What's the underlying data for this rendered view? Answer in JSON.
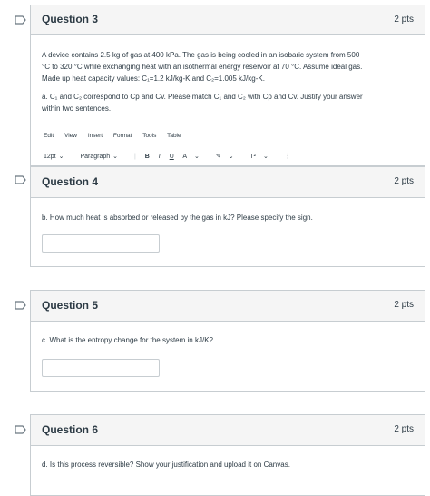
{
  "q3": {
    "title": "Question 3",
    "points": "2 pts",
    "para1_line1": "A device contains 2.5 kg of gas at 400 kPa. The gas is being cooled in an isobaric system from 500",
    "para1_line2": "°C to 320 °C while exchanging heat with an isothermal energy reservoir at 70 °C. Assume ideal gas.",
    "para1_line3": "Made up heat capacity values: C₁=1.2 kJ/kg-K and C₂=1.005 kJ/kg-K.",
    "para2_line1": "a. C₁ and C₂ correspond to Cp and Cv. Please match C₁ and C₂ with Cp and Cv. Justify your answer",
    "para2_line2": "within two sentences.",
    "menu": [
      "Edit",
      "View",
      "Insert",
      "Format",
      "Tools",
      "Table"
    ],
    "font_size": "12pt",
    "block_format": "Paragraph",
    "format_buttons": [
      "B",
      "I",
      "U",
      "A",
      "T²"
    ]
  },
  "q4": {
    "title": "Question 4",
    "points": "2 pts",
    "text": "b. How much heat is absorbed or released by the gas in kJ? Please specify the sign."
  },
  "q5": {
    "title": "Question 5",
    "points": "2 pts",
    "text": "c. What is the entropy change for the system in kJ/K?"
  },
  "q6": {
    "title": "Question 6",
    "points": "2 pts",
    "text": "d. Is this process reversible? Show your justification and upload it on Canvas."
  },
  "icons": {
    "flag": "flag-outline-icon"
  },
  "colors": {
    "header_bg": "#f5f5f5",
    "border": "#c7cdd1",
    "text": "#2d3b45"
  }
}
